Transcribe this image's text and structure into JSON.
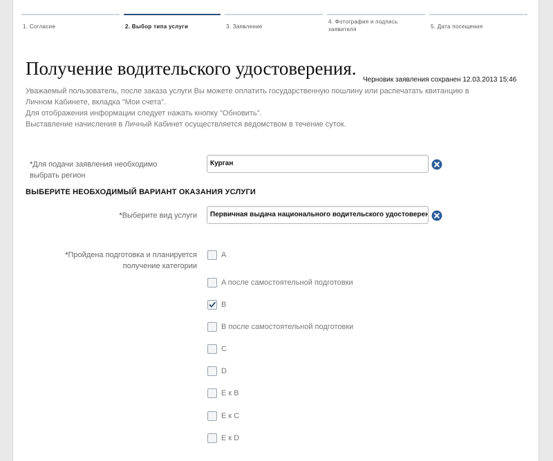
{
  "steps": [
    {
      "label": "1. Согласие",
      "active": false
    },
    {
      "label": "2. Выбор типа услуги",
      "active": true
    },
    {
      "label": "3. Заявление",
      "active": false
    },
    {
      "label": "4. Фотография и подпись заявителя",
      "active": false
    },
    {
      "label": "5. Дата посещения",
      "active": false
    }
  ],
  "title": "Получение водительского удостоверения.",
  "draft_status": "Черновик заявления сохранен 12.03.2013 15:46",
  "info": {
    "line1": "Уважаемый пользователь, после заказа услуги Вы можете оплатить государственную пошлину или распечатать квитанцию в",
    "line2": "Личном Кабинете, вкладка \"Мои счета\".",
    "line3": "Для отображения информации следует нажать кнопку \"Обновить\".",
    "line4": "Выставление начисления в Личный Кабинет осуществляется ведомством в течение суток."
  },
  "region": {
    "required_mark": "*",
    "label_line1": "Для подачи заявления необходимо",
    "label_line2": "выбрать регион",
    "value": "Курган"
  },
  "section_title": "ВЫБЕРИТЕ НЕОБХОДИМЫЙ ВАРИАНТ ОКАЗАНИЯ УСЛУГИ",
  "service": {
    "required_mark": "*",
    "label": "Выберите вид услуги",
    "value": "Первичная выдача национального водительского удостоверения"
  },
  "categories": {
    "required_mark": "*",
    "label_line1": "Пройдена подготовка и планируется",
    "label_line2": "получение категории",
    "options": [
      {
        "label": "A",
        "checked": false
      },
      {
        "label": "A после самостоятельной подготовки",
        "checked": false
      },
      {
        "label": "B",
        "checked": true
      },
      {
        "label": "B после самостоятельной подготовки",
        "checked": false
      },
      {
        "label": "C",
        "checked": false
      },
      {
        "label": "D",
        "checked": false
      },
      {
        "label": "E к B",
        "checked": false
      },
      {
        "label": "E к C",
        "checked": false
      },
      {
        "label": "E к D",
        "checked": false
      }
    ]
  },
  "colors": {
    "accent": "#2f4f7a",
    "clear_button": "#2b5d99"
  }
}
